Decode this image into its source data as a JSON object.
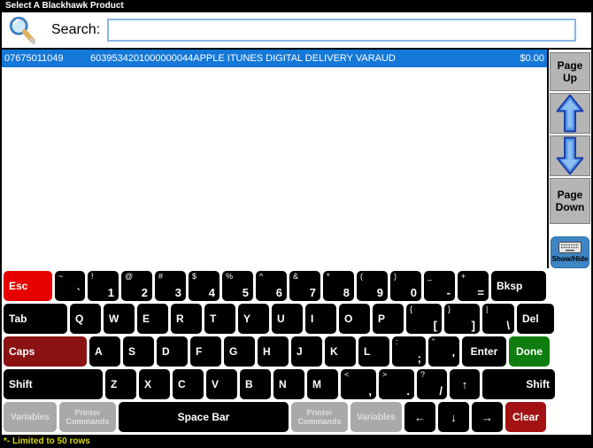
{
  "window": {
    "title": "Select A Blackhawk Product"
  },
  "search": {
    "label": "Search:",
    "value": "",
    "icon": "magnifier-icon"
  },
  "results": {
    "rows": [
      {
        "upc": "07675011049",
        "code": "6039534201000000044",
        "description": "APPLE ITUNES DIGITAL DELIVERY VARAUD",
        "price": "$0.00",
        "selected": true
      }
    ]
  },
  "sidebar": {
    "page_up": "Page Up",
    "page_down": "Page Down",
    "show_hide": "Show/Hide",
    "up_icon": "arrow-up-icon",
    "down_icon": "arrow-down-icon",
    "show_hide_icon": "keyboard-icon"
  },
  "status": {
    "text": "*- Limited to 50 rows"
  },
  "colors": {
    "selected_row": "#1478d8",
    "esc_key": "#e80000",
    "caps_key": "#8b1212",
    "done_key": "#0e7c0e",
    "clear_key": "#a31212",
    "gray_key": "#a9a9a9",
    "show_hide_button": "#3f85c4",
    "status_text": "#d8d800",
    "search_border": "#8ab4e8"
  },
  "keyboard": {
    "rows": [
      [
        {
          "id": "esc",
          "label": "Esc"
        },
        {
          "id": "backtick",
          "shift": "~",
          "main": "`"
        },
        {
          "id": "1",
          "shift": "!",
          "main": "1"
        },
        {
          "id": "2",
          "shift": "@",
          "main": "2"
        },
        {
          "id": "3",
          "shift": "#",
          "main": "3"
        },
        {
          "id": "4",
          "shift": "$",
          "main": "4"
        },
        {
          "id": "5",
          "shift": "%",
          "main": "5"
        },
        {
          "id": "6",
          "shift": "^",
          "main": "6"
        },
        {
          "id": "7",
          "shift": "&",
          "main": "7"
        },
        {
          "id": "8",
          "shift": "*",
          "main": "8"
        },
        {
          "id": "9",
          "shift": "(",
          "main": "9"
        },
        {
          "id": "0",
          "shift": ")",
          "main": "0"
        },
        {
          "id": "minus",
          "shift": "_",
          "main": "-"
        },
        {
          "id": "equals",
          "shift": "+",
          "main": "="
        },
        {
          "id": "bksp",
          "label": "Bksp"
        }
      ],
      [
        {
          "id": "tab",
          "label": "Tab"
        },
        {
          "id": "q",
          "label": "Q"
        },
        {
          "id": "w",
          "label": "W"
        },
        {
          "id": "e",
          "label": "E"
        },
        {
          "id": "r",
          "label": "R"
        },
        {
          "id": "t",
          "label": "T"
        },
        {
          "id": "y",
          "label": "Y"
        },
        {
          "id": "u",
          "label": "U"
        },
        {
          "id": "i",
          "label": "I"
        },
        {
          "id": "o",
          "label": "O"
        },
        {
          "id": "p",
          "label": "P"
        },
        {
          "id": "lbracket",
          "shift": "{",
          "main": "["
        },
        {
          "id": "rbracket",
          "shift": "}",
          "main": "]"
        },
        {
          "id": "backslash",
          "shift": "|",
          "main": "\\"
        },
        {
          "id": "del",
          "label": "Del"
        }
      ],
      [
        {
          "id": "caps",
          "label": "Caps"
        },
        {
          "id": "a",
          "label": "A"
        },
        {
          "id": "s",
          "label": "S"
        },
        {
          "id": "d",
          "label": "D"
        },
        {
          "id": "f",
          "label": "F"
        },
        {
          "id": "g",
          "label": "G"
        },
        {
          "id": "h",
          "label": "H"
        },
        {
          "id": "j",
          "label": "J"
        },
        {
          "id": "k",
          "label": "K"
        },
        {
          "id": "l",
          "label": "L"
        },
        {
          "id": "semicolon",
          "shift": ":",
          "main": ";"
        },
        {
          "id": "quote",
          "shift": "\"",
          "main": "'"
        },
        {
          "id": "enter",
          "label": "Enter"
        },
        {
          "id": "done",
          "label": "Done"
        }
      ],
      [
        {
          "id": "lshift",
          "label": "Shift"
        },
        {
          "id": "z",
          "label": "Z"
        },
        {
          "id": "x",
          "label": "X"
        },
        {
          "id": "c",
          "label": "C"
        },
        {
          "id": "v",
          "label": "V"
        },
        {
          "id": "b",
          "label": "B"
        },
        {
          "id": "n",
          "label": "N"
        },
        {
          "id": "m",
          "label": "M"
        },
        {
          "id": "comma",
          "shift": "<",
          "main": ","
        },
        {
          "id": "period",
          "shift": ">",
          "main": "."
        },
        {
          "id": "slash",
          "shift": "?",
          "main": "/"
        },
        {
          "id": "up",
          "label": "↑"
        },
        {
          "id": "rshift",
          "label": "Shift"
        }
      ],
      [
        {
          "id": "variables1",
          "label": "Variables"
        },
        {
          "id": "printer1",
          "label": "Printer Commands"
        },
        {
          "id": "space",
          "label": "Space Bar"
        },
        {
          "id": "printer2",
          "label": "Printer Commands"
        },
        {
          "id": "variables2",
          "label": "Variables"
        },
        {
          "id": "left",
          "label": "←"
        },
        {
          "id": "down",
          "label": "↓"
        },
        {
          "id": "right",
          "label": "→"
        },
        {
          "id": "clear",
          "label": "Clear"
        }
      ]
    ]
  }
}
